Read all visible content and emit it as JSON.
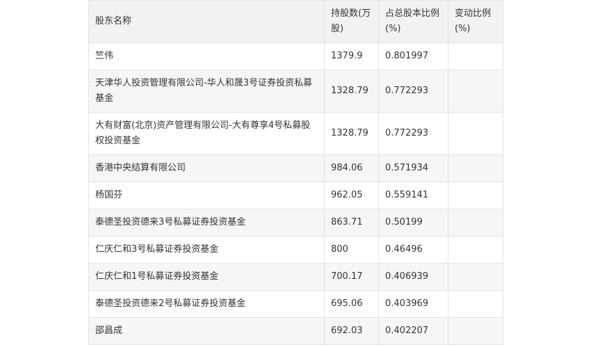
{
  "table": {
    "headers": [
      "股东名称",
      "持股数(万股)",
      "占总股本比例(%)",
      "变动比例(%)"
    ],
    "rows": [
      [
        "竺伟",
        "1379.9",
        "0.801997",
        ""
      ],
      [
        "天津华人投资管理有限公司-华人和晟3号证券投资私募基金",
        "1328.79",
        "0.772293",
        ""
      ],
      [
        "大有财富(北京)资产管理有限公司-大有尊享4号私募股权投资基金",
        "1328.79",
        "0.772293",
        ""
      ],
      [
        "香港中央结算有限公司",
        "984.06",
        "0.571934",
        ""
      ],
      [
        "杨国芬",
        "962.05",
        "0.559141",
        ""
      ],
      [
        "泰德圣投资德来3号私募证券投资基金",
        "863.71",
        "0.50199",
        ""
      ],
      [
        "仁庆仁和3号私募证券投资基金",
        "800",
        "0.46496",
        ""
      ],
      [
        "仁庆仁和1号私募证券投资基金",
        "700.17",
        "0.406939",
        ""
      ],
      [
        "泰德圣投资德来2号私募证券投资基金",
        "695.06",
        "0.403969",
        ""
      ],
      [
        "邵昌成",
        "692.03",
        "0.402207",
        ""
      ]
    ]
  }
}
